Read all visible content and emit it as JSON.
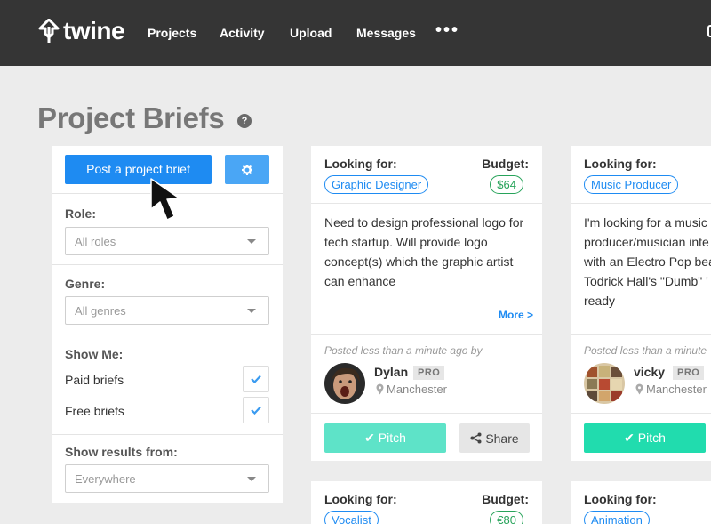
{
  "nav": {
    "logo_text": "twine",
    "items": [
      "Projects",
      "Activity",
      "Upload",
      "Messages"
    ],
    "more": "•••"
  },
  "page": {
    "title": "Project Briefs",
    "help": "?"
  },
  "sidebar": {
    "post_button": "Post a project brief",
    "role_label": "Role:",
    "role_value": "All roles",
    "genre_label": "Genre:",
    "genre_value": "All genres",
    "show_me_label": "Show Me:",
    "paid_label": "Paid briefs",
    "paid_checked": true,
    "free_label": "Free briefs",
    "free_checked": true,
    "results_label": "Show results from:",
    "results_value": "Everywhere"
  },
  "cards": [
    {
      "looking_for_label": "Looking for:",
      "budget_label": "Budget:",
      "role": "Graphic Designer",
      "budget": "$64",
      "description": "Need to design professional logo for tech startup. Will provide logo concept(s) which the graphic artist can enhance",
      "more": "More >",
      "posted": "Posted less than a minute ago by",
      "user": "Dylan",
      "badge": "PRO",
      "location": "Manchester",
      "pitch": "Pitch",
      "share": "Share",
      "pitch_color": "#5ee3c8"
    },
    {
      "looking_for_label": "Looking for:",
      "role": "Music Producer",
      "description": "I'm looking for a music producer/musician inte with an Electro Pop bea Todrick Hall's \"Dumb\" ' ready",
      "posted": "Posted less than a minute",
      "user": "vicky",
      "badge": "PRO",
      "location": "Manchester",
      "pitch": "Pitch",
      "pitch_color": "#21dcae"
    },
    {
      "looking_for_label": "Looking for:",
      "budget_label": "Budget:",
      "role": "Vocalist",
      "budget": "€80"
    },
    {
      "looking_for_label": "Looking for:",
      "role": "Animation"
    }
  ],
  "colors": {
    "nav_bg": "#353535",
    "page_bg": "#ececec",
    "accent_blue": "#1e8bf2",
    "budget_green": "#27a35a"
  }
}
